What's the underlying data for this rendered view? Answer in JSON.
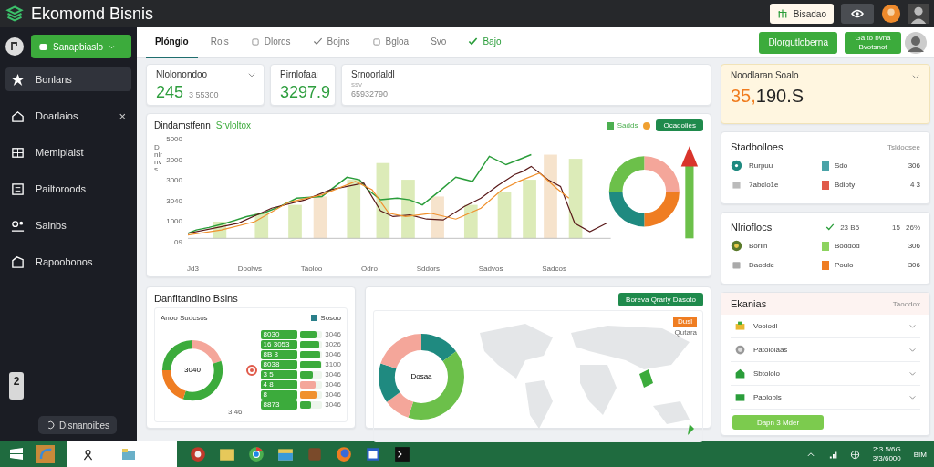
{
  "app": {
    "title": "Ekomomd Bisnis",
    "top_button": "Bisadao"
  },
  "sidebar": {
    "dropdown": "Sanapbiaslo",
    "items": [
      {
        "label": "Bonlans",
        "selected": true
      },
      {
        "label": "Doarlaios",
        "selected": false,
        "close": "×"
      },
      {
        "label": "Memlplaist",
        "selected": false
      },
      {
        "label": "Pailtoroods",
        "selected": false
      },
      {
        "label": "Sainbs",
        "selected": false
      },
      {
        "label": "Rapoobonos",
        "selected": false
      }
    ],
    "pager": "2",
    "status_pill": "Disnanoibes"
  },
  "tabs": [
    {
      "label": "Plóngio",
      "selected": true,
      "kind": "plain"
    },
    {
      "label": "Rois",
      "selected": false,
      "kind": "plain"
    },
    {
      "label": "Dlords",
      "selected": false,
      "kind": "box"
    },
    {
      "label": "Bojns",
      "selected": false,
      "kind": "check"
    },
    {
      "label": "Bgloa",
      "selected": false,
      "kind": "box"
    },
    {
      "label": "Svo",
      "selected": false,
      "kind": "plain"
    },
    {
      "label": "Bajo",
      "selected": false,
      "kind": "done"
    }
  ],
  "header_buttons": [
    "Dlorgutloberna",
    "Ga to bvna Bvotsnot"
  ],
  "kpis": [
    {
      "title": "Nlolonondoo",
      "value": "245",
      "sub": "3 55300",
      "expandable": true
    },
    {
      "title": "Pirnlofaai",
      "value": "3297.9",
      "expandable": false
    },
    {
      "title": "Srnoorlaldl",
      "caption": "ssv",
      "sub": "65932790",
      "expandable": false
    }
  ],
  "main_chart": {
    "title": "Dindamstfenn",
    "title_highlight": "Srvloltox",
    "y_axis_label": "Dnlrnvs",
    "legend": [
      {
        "label": "Sadds",
        "color": "#4caf50"
      },
      {
        "color": "#f0a030"
      }
    ],
    "action": "Ocadoiies",
    "y_ticks": [
      "5000",
      "2000",
      "3000",
      "3040",
      "1000",
      "09"
    ],
    "x_labels": [
      "Jd3",
      "Doolws",
      "Taoloo",
      "Odro",
      "Sddors",
      "Sadvos",
      "Sadcos"
    ]
  },
  "distribution": {
    "title": "Danfitandino Bsins",
    "subtitle": "Anoo Sudcsos",
    "legend": "Sosoo",
    "donut_center": "3040",
    "donut_note": "3 46",
    "bars": [
      {
        "label": "8030",
        "value": "3046",
        "level": 0.75,
        "color": "#3cab3c"
      },
      {
        "label": "16 3053",
        "value": "3026",
        "level": 0.85,
        "color": "#3cab3c"
      },
      {
        "label": "8B 8",
        "value": "3046",
        "level": 0.9,
        "color": "#3cab3c"
      },
      {
        "label": "8038",
        "value": "3100",
        "level": 0.95,
        "color": "#3cab3c"
      },
      {
        "label": "3 5",
        "value": "3046",
        "level": 0.6,
        "color": "#3cab3c"
      },
      {
        "label": "4 8",
        "value": "3046",
        "level": 0.7,
        "color": "#f4a69a"
      },
      {
        "label": "8",
        "value": "3046",
        "level": 0.75,
        "color": "#f0912e"
      },
      {
        "label": "8873",
        "value": "3046",
        "level": 0.5,
        "color": "#3cab3c"
      }
    ]
  },
  "region": {
    "button": "Boreva Qrarly Dasoto",
    "badge": "Dusl",
    "badge_caption": "Qutara",
    "donut_center": "Dosaa"
  },
  "sales_card": {
    "title": "Noodlaran Soalo",
    "value": "35,190.S"
  },
  "stats": {
    "title": "Stadbolloes",
    "action": "Tsldoosee",
    "rows": [
      {
        "label": "Rurpuu",
        "tag": "Sdo",
        "color": "#4aa3a8",
        "value": "306"
      },
      {
        "label": "7abclo1e",
        "tag": "Bdioty",
        "color": "#e05a4a",
        "value": "4 3"
      }
    ]
  },
  "metrics": {
    "title": "Nlrioflocs",
    "reading": "23 B5",
    "count": "15",
    "percent": "26%",
    "rows": [
      {
        "label": "Borlin",
        "tag": "Boddod",
        "color": "#8dd35f",
        "value": "306"
      },
      {
        "label": "Daodde",
        "tag": "Poulo",
        "color": "#ef7d22",
        "value": "306"
      }
    ]
  },
  "menu": {
    "title": "Ekanias",
    "action": "Taoodox",
    "items": [
      {
        "label": "Vooiodl"
      },
      {
        "label": "Patoiolaas"
      },
      {
        "label": "Sbtololo"
      },
      {
        "label": "Paolobls"
      }
    ],
    "button": "Dapn 3 Mder"
  },
  "taskbar": {
    "clock_time": "2:3 5/6G",
    "clock_date": "3/3/6000",
    "tray_text": "BIM"
  }
}
